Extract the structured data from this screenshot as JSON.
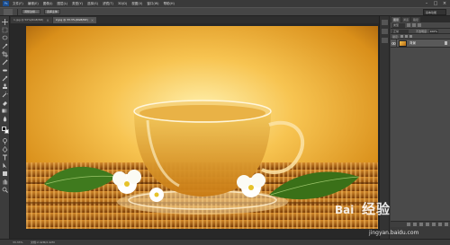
{
  "app": {
    "logo": "Ps",
    "menu": [
      "文件(F)",
      "编辑(E)",
      "图像(I)",
      "图层(L)",
      "类型(Y)",
      "选择(S)",
      "滤镜(T)",
      "3D(D)",
      "视图(V)",
      "窗口(W)",
      "帮助(H)"
    ],
    "window_controls": [
      "–",
      "□",
      "×"
    ]
  },
  "options_bar": {
    "buttons": [
      "调整边缘...",
      "选择主体"
    ],
    "workspace": "基本功能"
  },
  "tabs": [
    {
      "label": "1.jpg @ 50%(RGB/8#)",
      "active": false
    },
    {
      "label": "2.jpg @ 33.3%(RGB/8#)",
      "active": true
    }
  ],
  "layers_panel": {
    "tabs": [
      "图层",
      "通道",
      "路径"
    ],
    "kind_filter": "类型",
    "blend_mode": "正常",
    "opacity_label": "不透明度:",
    "opacity_value": "100%",
    "lock_label": "锁定:",
    "layers": [
      {
        "name": "背景",
        "visible": true,
        "locked": true
      }
    ]
  },
  "status": {
    "zoom": "33.33%",
    "doc_info": "文档:2.42M/2.42M"
  },
  "watermark": {
    "logo_text": "Bai",
    "brand": "经验",
    "url": "jingyan.baidu.com"
  },
  "icons": {
    "tools": [
      "move-icon",
      "marquee-icon",
      "lasso-icon",
      "quick-select-icon",
      "crop-icon",
      "eyedropper-icon",
      "healing-brush-icon",
      "brush-icon",
      "clone-stamp-icon",
      "history-brush-icon",
      "eraser-icon",
      "gradient-icon",
      "blur-icon",
      "dodge-icon",
      "pen-icon",
      "type-icon",
      "path-select-icon",
      "shape-icon",
      "hand-icon",
      "zoom-icon"
    ]
  },
  "colors": {
    "accent": "#1b4d8f",
    "image_highlight": "#fff2b0",
    "image_shadow": "#8a4a06"
  }
}
